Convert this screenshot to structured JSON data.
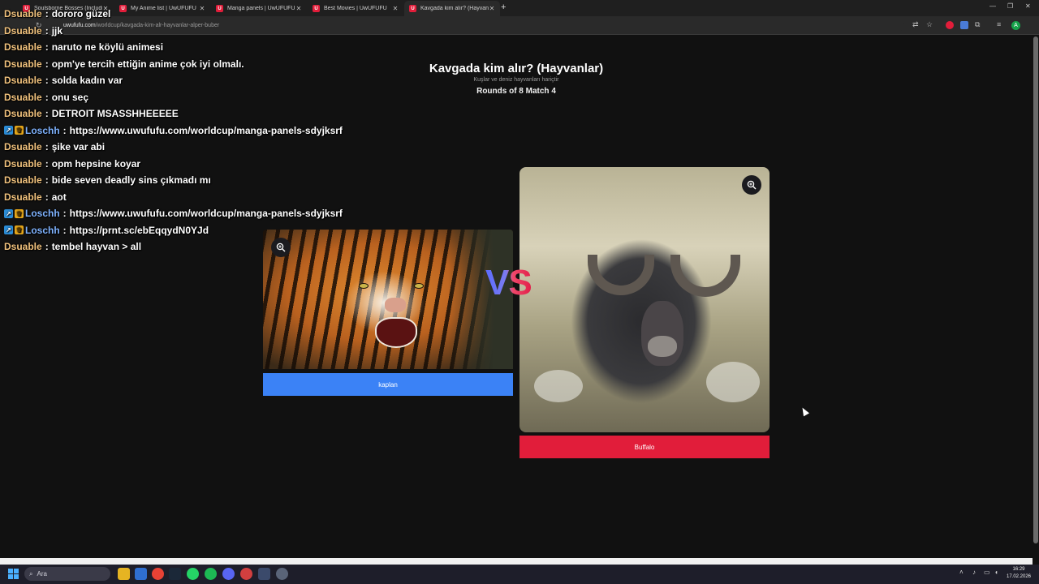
{
  "browser": {
    "tabs": [
      {
        "label": "Soulsborne Bosses (Including ...",
        "active": false
      },
      {
        "label": "My Anime list | UwUFUFU",
        "active": false
      },
      {
        "label": "Manga panels | UwUFUFU",
        "active": false
      },
      {
        "label": "Best Movies | UwUFUFU",
        "active": false
      },
      {
        "label": "Kavgada kim alır? (Hayvanlar) |",
        "active": true
      }
    ],
    "url_host": "uwufufu.com",
    "url_path": "/worldcup/kavgada-kim-alr-hayvanlar-alper-buber",
    "profile_initial": "A"
  },
  "page": {
    "title": "Kavgada kim alır? (Hayvanlar)",
    "subtitle": "Kuşlar ve deniz hayvanları hariçtir",
    "round": "Rounds of 8 Match 4",
    "vs": "VS",
    "left": {
      "label": "kaplan",
      "image": "tiger"
    },
    "right": {
      "label": "Buffalo",
      "image": "buffalo"
    }
  },
  "chat": [
    {
      "user": "Dsuable",
      "text": "dororo güzel",
      "badges": false
    },
    {
      "user": "Dsuable",
      "text": "jjk",
      "badges": false
    },
    {
      "user": "Dsuable",
      "text": "naruto ne köylü animesi",
      "badges": false
    },
    {
      "user": "Dsuable",
      "text": "opm'ye tercih ettiğin anime çok iyi olmalı.",
      "badges": false
    },
    {
      "user": "Dsuable",
      "text": "solda kadın var",
      "badges": false
    },
    {
      "user": "Dsuable",
      "text": "onu seç",
      "badges": false
    },
    {
      "user": "Dsuable",
      "text": "DETROIT MSASSHHEEEEE",
      "badges": false
    },
    {
      "user": "Loschh",
      "text": "https://www.uwufufu.com/worldcup/manga-panels-sdyjksrf",
      "badges": true
    },
    {
      "user": "Dsuable",
      "text": "şike var abi",
      "badges": false
    },
    {
      "user": "Dsuable",
      "text": "opm hepsine koyar",
      "badges": false
    },
    {
      "user": "Dsuable",
      "text": "bide seven deadly sins çıkmadı mı",
      "badges": false
    },
    {
      "user": "Dsuable",
      "text": "aot",
      "badges": false
    },
    {
      "user": "Loschh",
      "text": "https://www.uwufufu.com/worldcup/manga-panels-sdyjksrf",
      "badges": true
    },
    {
      "user": "Loschh",
      "text": "https://prnt.sc/ebEqqydN0YJd",
      "badges": true
    },
    {
      "user": "Dsuable",
      "text": "tembel hayvan > all",
      "badges": false
    }
  ],
  "taskbar": {
    "search_label": "Ara",
    "time": "16:29",
    "date": "17.02.2026"
  },
  "colors": {
    "left_button": "#3b82f6",
    "right_button": "#e11d3a",
    "chat_user": "#f1c27d",
    "chat_user_alt": "#7fb3ff",
    "background": "#111111"
  }
}
